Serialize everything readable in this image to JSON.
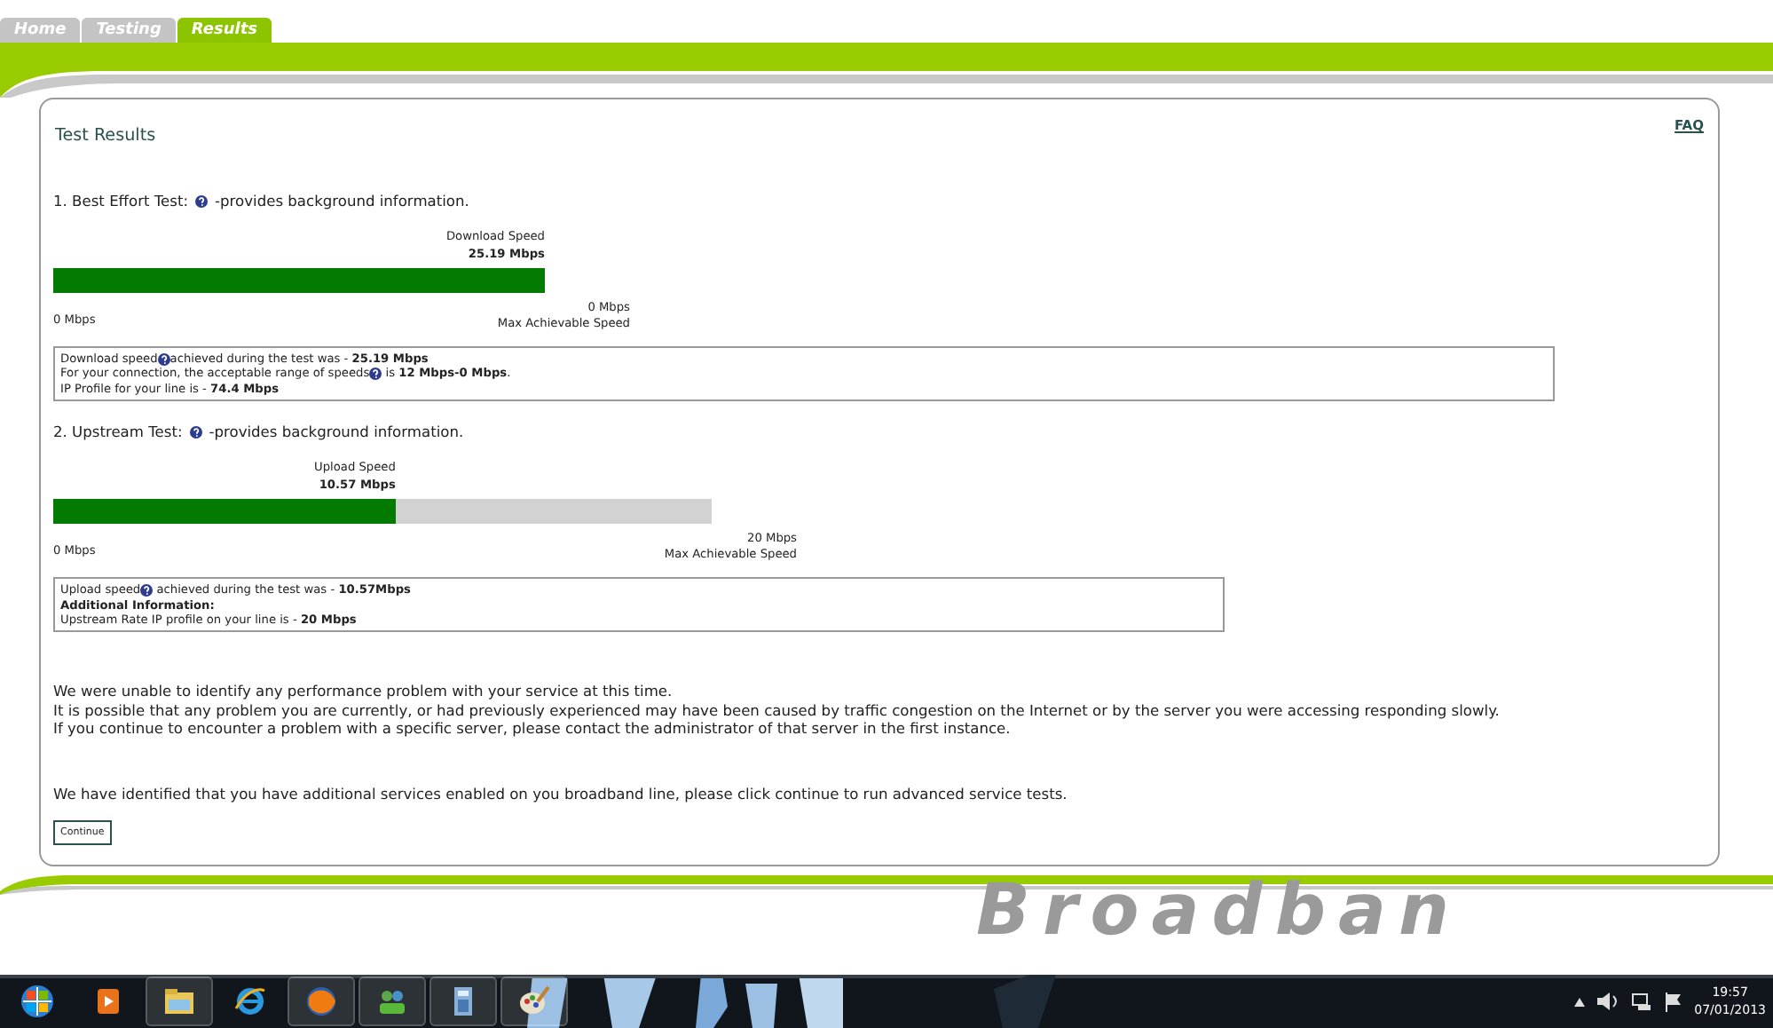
{
  "tabs": [
    {
      "label": "Home",
      "selected": false
    },
    {
      "label": "Testing",
      "selected": false
    },
    {
      "label": "Results",
      "selected": true
    }
  ],
  "card": {
    "title": "Test Results",
    "faq": "FAQ"
  },
  "tests": [
    {
      "title": "1. Best Effort Test:",
      "note": "-provides background information.",
      "bar_label": "Download Speed",
      "bar_value": "25.19 Mbps",
      "level": 1,
      "min": "0 Mbps",
      "max": "0 Mbps",
      "max_caption": "Max Achievable Speed",
      "info": [
        {
          "before": "Download speed",
          "after": "achieved during the test was - **25.19 Mbps**",
          "help": true
        },
        {
          "before": "For your connection, the acceptable range of speeds",
          "after": " is **12 Mbps-0 Mbps**.",
          "help": true
        },
        {
          "before": "IP Profile for your line is - **74.4 Mbps**",
          "help": false
        }
      ]
    },
    {
      "title": "2. Upstream Test:",
      "note": "-provides background information.",
      "bar_label": "Upload Speed",
      "bar_value": "10.57 Mbps",
      "level": 0.52,
      "min": "0 Mbps",
      "max": "20 Mbps",
      "max_caption": "Max Achievable Speed",
      "info": [
        {
          "before": "Upload speed",
          "after": " achieved during the test was - **10.57Mbps**",
          "help": true
        },
        {
          "before": "**Additional Information:**",
          "help": false
        },
        {
          "before": "Upstream Rate IP profile on your line is - **20 Mbps**",
          "help": false
        }
      ]
    }
  ],
  "messages": [
    "We were unable to identify any performance problem with your service at this time.",
    "It is possible that any problem you are currently, or had previously experienced may have been caused by traffic congestion on the Internet or by the server you were accessing responding slowly.",
    "If you continue to encounter a problem with a specific server, please contact the administrator of that server in the first instance."
  ],
  "advanced_message": "We have identified that you have additional services enabled on you broadband line, please click continue to run advanced service tests.",
  "continue_button": "Continue",
  "footer_logo": "Broadban",
  "taskbar": {
    "time": "19:57",
    "date": "07/01/2013"
  }
}
